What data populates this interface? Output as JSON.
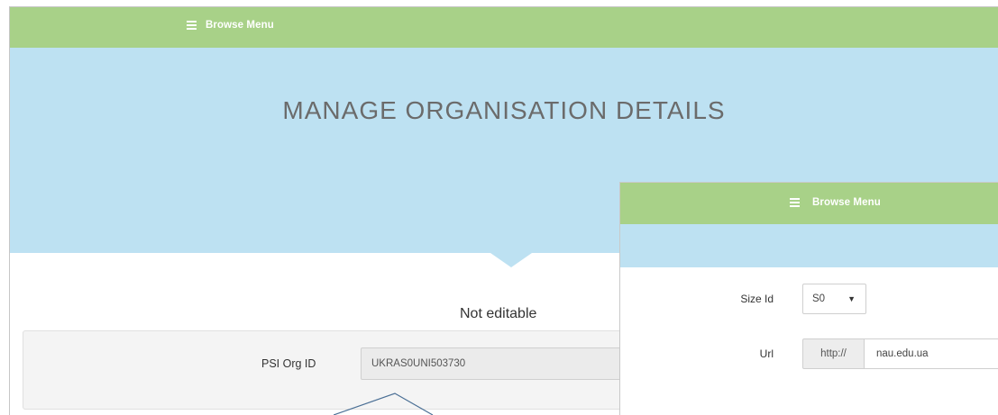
{
  "header": {
    "menu_label": "Browse Menu"
  },
  "hero": {
    "title": "MANAGE ORGANISATION DETAILS"
  },
  "section": {
    "label": "Not editable"
  },
  "form": {
    "psi_org_id_label": "PSI Org ID",
    "psi_org_id_value": "UKRAS0UNI503730"
  },
  "overlay": {
    "menu_label": "Browse Menu",
    "size_id_label": "Size Id",
    "size_id_value": "S0",
    "url_label": "Url",
    "url_prefix": "http://",
    "url_value": "nau.edu.ua"
  },
  "colors": {
    "topbar": "#a8d188",
    "hero": "#bde1f2",
    "panel": "#f4f4f4"
  },
  "icons": {
    "menu": "hamburger-icon",
    "select_caret": "caret-down-icon"
  }
}
